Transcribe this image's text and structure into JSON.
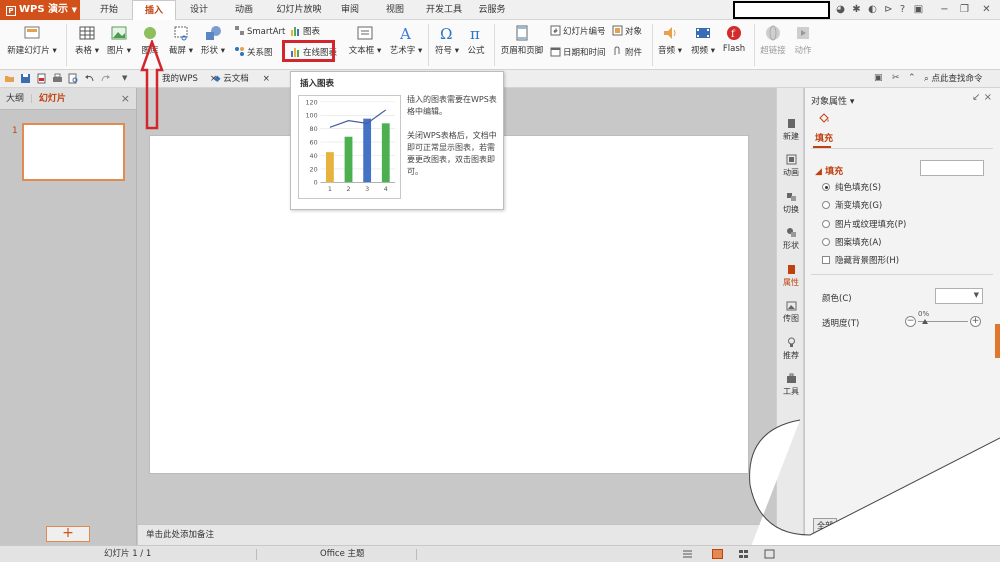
{
  "app": {
    "name": "WPS 演示",
    "logo": "P"
  },
  "menu": {
    "tabs": [
      "开始",
      "插入",
      "设计",
      "动画",
      "幻灯片放映",
      "审阅",
      "视图",
      "开发工具",
      "云服务"
    ],
    "active": "插入"
  },
  "ribbon": {
    "new_slide": "新建幻灯片",
    "table": "表格",
    "picture": "图片",
    "shape_lib": "图库",
    "screenshot": "截屏",
    "shape": "形状",
    "smartart": "SmartArt",
    "chart": "图表",
    "relation": "关系图",
    "online_chart": "在线图表",
    "textbox": "文本框",
    "wordart": "艺术字",
    "symbol": "符号",
    "formula": "公式",
    "header_footer": "页眉和页脚",
    "slide_number": "幻灯片编号",
    "datetime": "日期和时间",
    "object": "对象",
    "attachment": "附件",
    "audio": "音频",
    "video": "视频",
    "flash": "Flash",
    "hyperlink": "超链接",
    "action": "动作"
  },
  "quickbar": {
    "doc_tab1": "我的WPS",
    "doc_tab2": "云文档",
    "search": "点此查找命令"
  },
  "left_pane": {
    "tab_outline": "大纲",
    "tab_slides": "幻灯片",
    "slide_index": "1",
    "add": "+"
  },
  "notes": {
    "placeholder": "单击此处添加备注"
  },
  "tooltip": {
    "title": "插入图表",
    "text1": "插入的图表需要在WPS表格中编辑。",
    "text2": "关闭WPS表格后，文档中即可正常显示图表，若需要更改图表，双击图表即可。"
  },
  "chart_data": {
    "type": "bar",
    "categories": [
      "1",
      "2",
      "3",
      "4"
    ],
    "values": [
      45,
      68,
      95,
      88
    ],
    "line_values": [
      82,
      92,
      88,
      108
    ],
    "ylim": [
      0,
      120
    ],
    "yticks": [
      0,
      20,
      40,
      60,
      80,
      100,
      120
    ],
    "colors": [
      "#e8b23e",
      "#4caf50",
      "#4472c4",
      "#4caf50"
    ],
    "line_color": "#4a5c9c"
  },
  "side_strip": {
    "items": [
      "新建",
      "动画",
      "切换",
      "形状",
      "属性",
      "传图",
      "推荐",
      "工具"
    ],
    "active": "属性"
  },
  "props": {
    "title": "对象属性",
    "tab": "填充",
    "section": "填充",
    "options": [
      "纯色填充(S)",
      "渐变填充(G)",
      "图片或纹理填充(P)",
      "图案填充(A)"
    ],
    "hide_bg": "隐藏背景图形(H)",
    "color_label": "颜色(C)",
    "transparency_label": "透明度(T)",
    "transparency_value": "0%",
    "bottom_btn": "全部"
  },
  "status": {
    "slide": "幻灯片 1 / 1",
    "theme": "Office 主题"
  }
}
